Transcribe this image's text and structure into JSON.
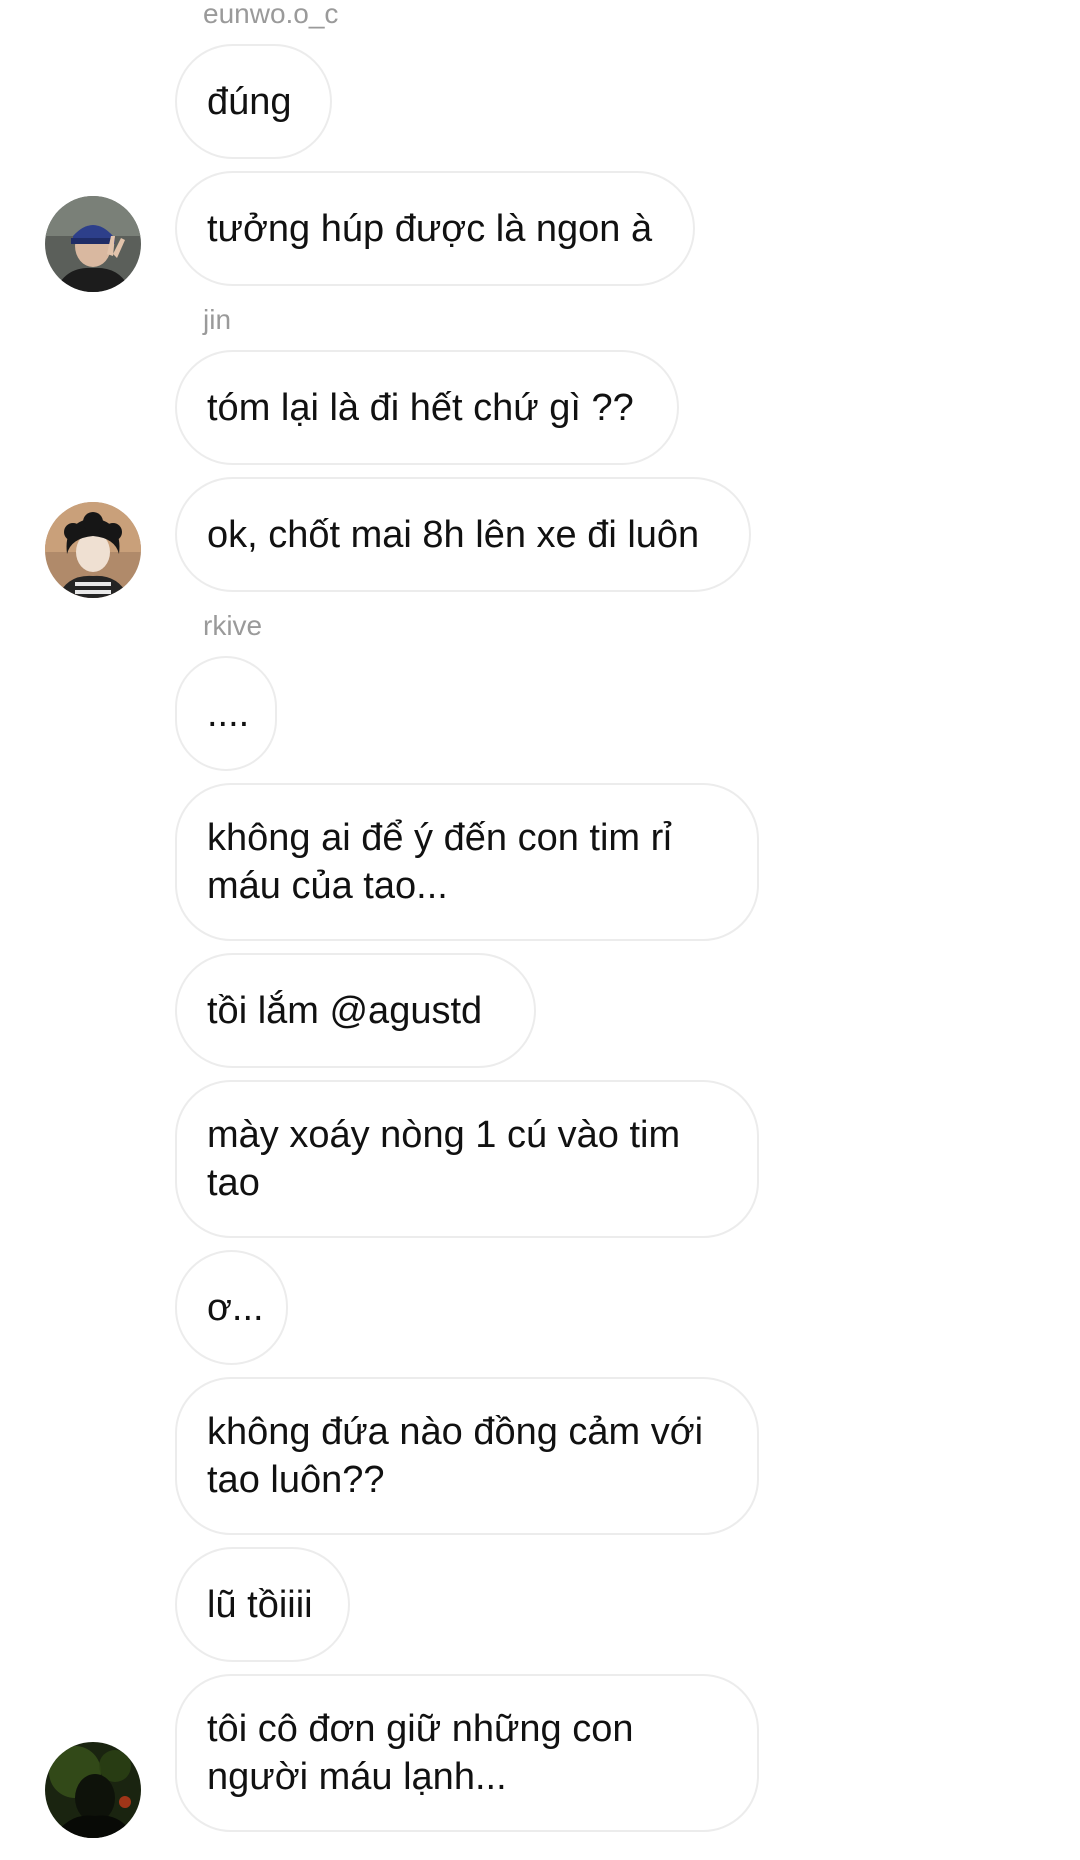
{
  "conversation": {
    "groups": [
      {
        "sender": "eunwo.o_c",
        "messages": [
          "đúng",
          "tưởng húp được là ngon à"
        ]
      },
      {
        "sender": "jin",
        "messages": [
          "tóm lại là đi hết chứ gì ??",
          "ok, chốt mai 8h lên xe đi luôn"
        ]
      },
      {
        "sender": "rkive",
        "messages": [
          "....",
          "không ai để ý đến con tim rỉ máu của tao...",
          "tồi lắm @agustd",
          "mày xoáy nòng 1 cú vào tim tao",
          "ơ...",
          "không đứa nào đồng cảm với tao luôn??",
          "lũ tồiiii",
          "tôi cô đơn giữ những con người máu lạnh..."
        ]
      }
    ]
  },
  "avatars": [
    {
      "icon": "user-photo-avatar-blue-cap"
    },
    {
      "icon": "user-photo-avatar-curly-hair"
    },
    {
      "icon": "user-photo-avatar-dark"
    }
  ],
  "colors": {
    "background": "#ffffff",
    "bubble_border": "#ececec",
    "sender_name": "#9a9a9a",
    "message_text": "#111111"
  }
}
